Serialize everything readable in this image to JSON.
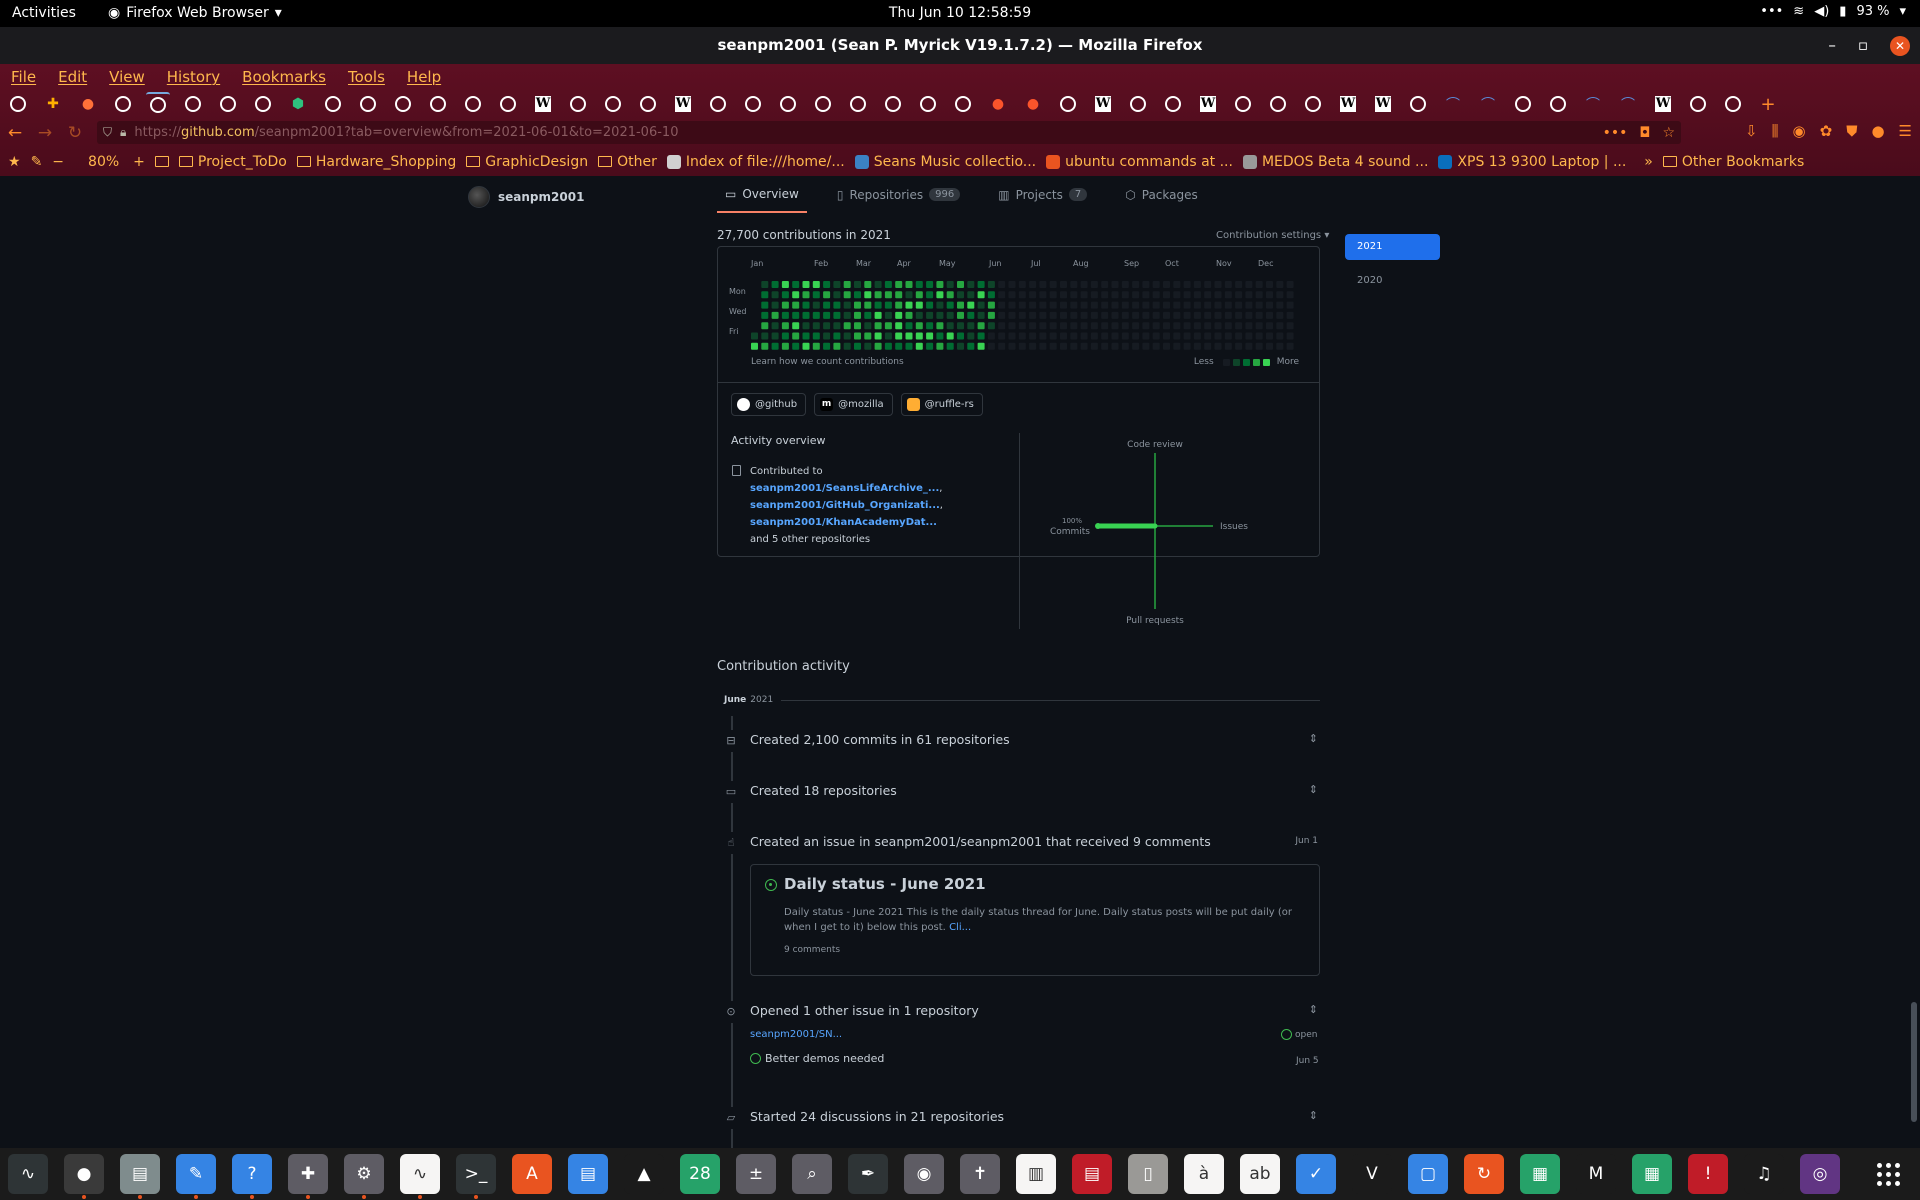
{
  "topbar": {
    "activities": "Activities",
    "app_menu": "Firefox Web Browser",
    "clock": "Thu Jun 10  12:58:59",
    "battery": "93 %"
  },
  "window": {
    "title": "seanpm2001 (Sean P. Myrick V19.1.7.2) — Mozilla Firefox"
  },
  "menu": [
    "File",
    "Edit",
    "View",
    "History",
    "Bookmarks",
    "Tools",
    "Help"
  ],
  "tabs": [
    "gh",
    "ext",
    "ff",
    "gh",
    "gh-active",
    "gh",
    "gh",
    "gh",
    "sh",
    "gh",
    "gh",
    "gh",
    "gh",
    "gh",
    "gh",
    "wk",
    "gh",
    "gh",
    "gh",
    "wk",
    "gh",
    "gh",
    "gh",
    "gh",
    "gh",
    "gh",
    "gh",
    "gh",
    "brave",
    "brave",
    "gh",
    "wk",
    "gh",
    "gh",
    "wk",
    "gh",
    "gh",
    "gh",
    "wk",
    "wk",
    "gh",
    "bridge",
    "bridge",
    "gh",
    "gh",
    "bridge",
    "bridge",
    "wk",
    "gh",
    "gh",
    "plus"
  ],
  "url": {
    "scheme": "https://",
    "host": "github.com",
    "rest": "/seanpm2001?tab=overview&from=2021-06-01&to=2021-06-10"
  },
  "bookmarks": {
    "zoom": "80%",
    "items": [
      {
        "label": "Project_ToDo",
        "kind": "folder"
      },
      {
        "label": "Hardware_Shopping",
        "kind": "folder"
      },
      {
        "label": "GraphicDesign",
        "kind": "folder"
      },
      {
        "label": "Other",
        "kind": "folder"
      },
      {
        "label": "Index of file:///home/...",
        "kind": "page",
        "color": "#d0d0d0"
      },
      {
        "label": "Seans Music collectio...",
        "kind": "page",
        "color": "#3b82c4"
      },
      {
        "label": "ubuntu commands at ...",
        "kind": "page",
        "color": "#e95420"
      },
      {
        "label": "MEDOS Beta 4 sound ...",
        "kind": "page",
        "color": "#999999"
      },
      {
        "label": "XPS 13 9300 Laptop | ...",
        "kind": "page",
        "color": "#0a6ebd"
      }
    ],
    "overflow": "»",
    "other": "Other Bookmarks"
  },
  "profile": {
    "username": "seanpm2001",
    "tabs": [
      {
        "label": "Overview",
        "count": ""
      },
      {
        "label": "Repositories",
        "count": "996"
      },
      {
        "label": "Projects",
        "count": "7"
      },
      {
        "label": "Packages",
        "count": ""
      }
    ]
  },
  "contributions": {
    "heading": "27,700 contributions in 2021",
    "settings": "Contribution settings ▾",
    "months": [
      "Jan",
      "Feb",
      "Mar",
      "Apr",
      "May",
      "Jun",
      "Jul",
      "Aug",
      "Sep",
      "Oct",
      "Nov",
      "Dec"
    ],
    "days": [
      "Mon",
      "Wed",
      "Fri"
    ],
    "learn": "Learn how we count contributions",
    "less": "Less",
    "more": "More",
    "level_colors": [
      "#161b22",
      "#0e4429",
      "#006d32",
      "#26a641",
      "#39d353"
    ],
    "orgs": [
      "@github",
      "@mozilla",
      "@ruffle-rs"
    ]
  },
  "activity_overview": {
    "title": "Activity overview",
    "contributed_to": "Contributed to",
    "repos": [
      "seanpm2001/SeansLifeArchive_...",
      "seanpm2001/GitHub_Organizati...",
      "seanpm2001/KhanAcademyDat..."
    ],
    "others": "and 5 other repositories",
    "axes": {
      "top": "Code review",
      "right": "Issues",
      "bottom": "Pull requests",
      "left": "Commits"
    },
    "commits_pct": "100%"
  },
  "activity": {
    "title": "Contribution activity",
    "month": "June",
    "year": "2021",
    "events": [
      {
        "text": "Created 2,100 commits in 61 repositories"
      },
      {
        "text": "Created 18 repositories"
      },
      {
        "text": "Created an issue in seanpm2001/seanpm2001 that received 9 comments",
        "date": "Jun 1"
      },
      {
        "text": "Opened 1 other issue in 1 repository"
      },
      {
        "text": "Started 24 discussions in 21 repositories"
      }
    ],
    "issue": {
      "title": "Daily status - June 2021",
      "body": "Daily status - June 2021 This is the daily status thread for June. Daily status posts will be put daily (or when I get to it) below this post.",
      "more": "Cli...",
      "comments": "9 comments"
    },
    "other_issue": {
      "repo": "seanpm2001/SN...",
      "state": "open",
      "title": "Better demos needed",
      "date": "Jun 5"
    }
  },
  "years": [
    "2021",
    "2020"
  ],
  "dock": [
    "monitor",
    "firefox",
    "files",
    "editor",
    "help",
    "ext",
    "settings",
    "graph",
    "terminal",
    "store",
    "writer",
    "vlc",
    "calendar",
    "calc",
    "search",
    "inkscape",
    "disk",
    "bible",
    "news",
    "reader",
    "archive",
    "char",
    "dict",
    "todo",
    "vim",
    "window",
    "update",
    "layers",
    "mario",
    "sheet",
    "alert",
    "music",
    "camera"
  ]
}
